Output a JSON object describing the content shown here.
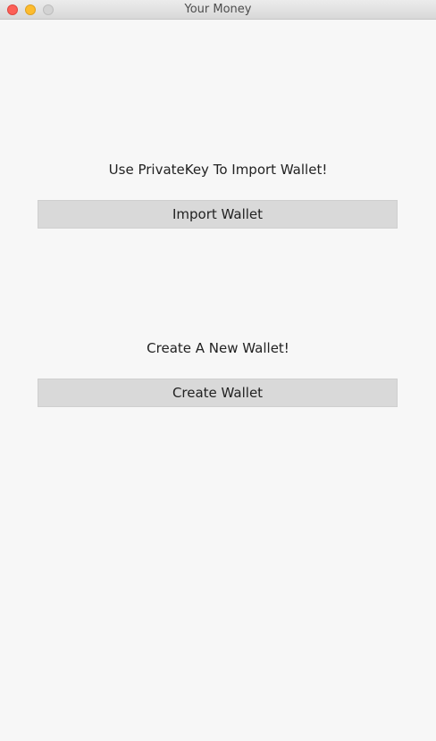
{
  "window": {
    "title": "Your Money"
  },
  "import_section": {
    "prompt": "Use PrivateKey To Import Wallet!",
    "button_label": "Import Wallet"
  },
  "create_section": {
    "prompt": "Create A New Wallet!",
    "button_label": "Create Wallet"
  },
  "colors": {
    "background": "#f7f7f7",
    "button_bg": "#d9d9d9",
    "close": "#fc5f57",
    "minimize": "#fdbc2e",
    "zoom_disabled": "#d3d3d3"
  }
}
